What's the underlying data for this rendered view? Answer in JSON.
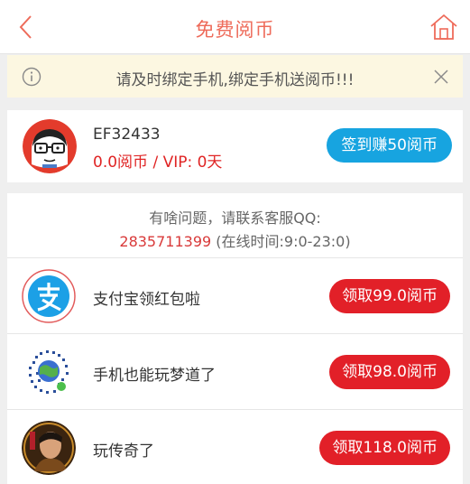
{
  "header": {
    "title": "免费阅币",
    "back_icon": "chevron-left-icon",
    "home_icon": "home-icon"
  },
  "notice": {
    "text": "请及时绑定手机,绑定手机送阅币!!!",
    "info_icon": "info-icon",
    "close_icon": "close-icon"
  },
  "user": {
    "name": "EF32433",
    "balance": "0.0阅币 / VIP: 0天",
    "checkin_label": "签到赚50阅币"
  },
  "support": {
    "line1": "有啥问题，请联系客服QQ:",
    "qq": "2835711399",
    "hours": " (在线时间:9:0-23:0)"
  },
  "offers": [
    {
      "title": "支付宝领红包啦",
      "button": "领取99.0阅币",
      "icon": "alipay-icon"
    },
    {
      "title": "手机也能玩梦道了",
      "button": "领取98.0阅币",
      "icon": "qr-code-icon"
    },
    {
      "title": "玩传奇了",
      "button": "领取118.0阅币",
      "icon": "game-avatar-icon"
    }
  ],
  "colors": {
    "accent_red": "#e22028",
    "title_coral": "#ee6b5a",
    "checkin_blue": "#17a4e0",
    "notice_bg": "#fcf7e1"
  }
}
